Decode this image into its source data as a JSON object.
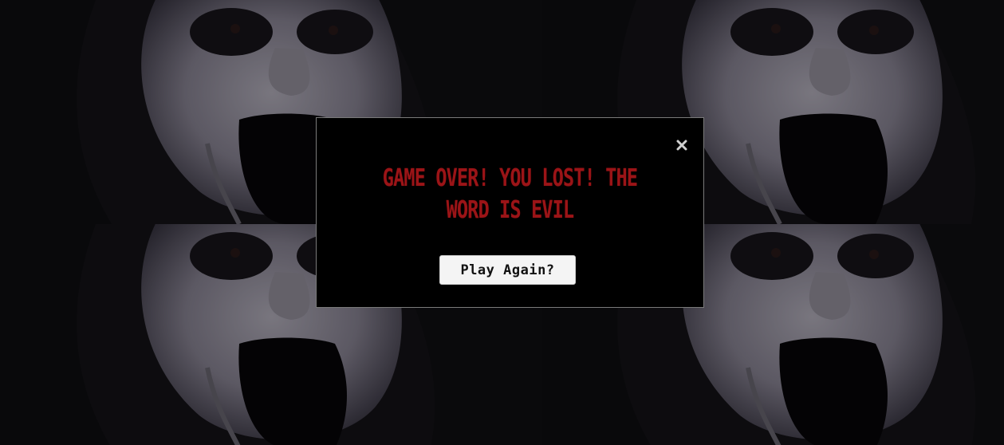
{
  "background": {
    "image_description_icon": "screaming-face-image",
    "tile_count": 4
  },
  "modal": {
    "message": "Game Over! You lost! The word is EVIL",
    "close_icon": "close-icon",
    "play_again_label": "Play Again?"
  },
  "colors": {
    "message_red": "#9b1417",
    "modal_bg": "#000000",
    "button_bg": "#f4f4f4"
  }
}
